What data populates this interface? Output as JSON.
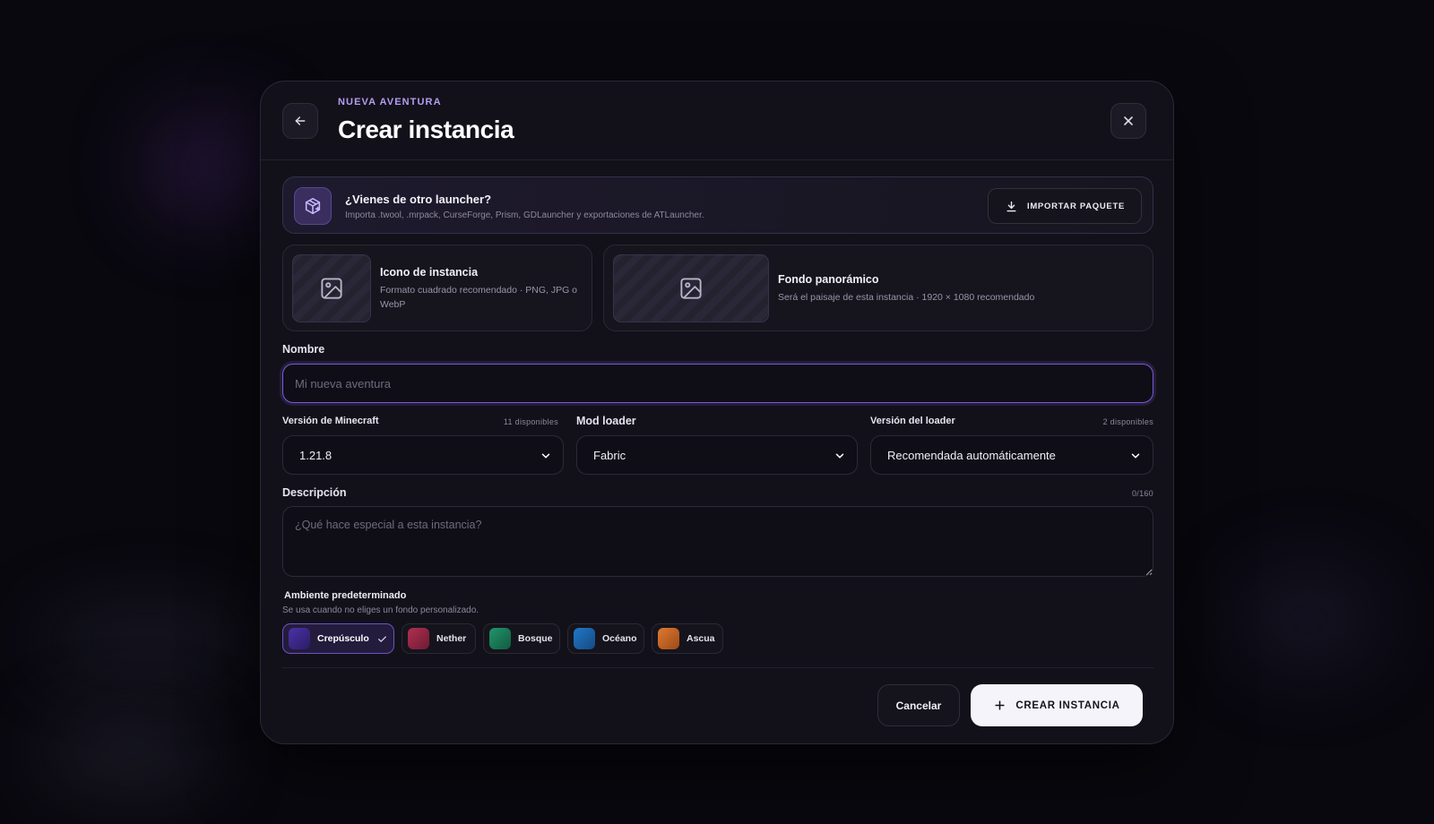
{
  "header": {
    "eyebrow": "NUEVA AVENTURA",
    "title": "Crear instancia"
  },
  "import": {
    "title": "¿Vienes de otro launcher?",
    "subtitle": "Importa .twool, .mrpack, CurseForge, Prism, GDLauncher y exportaciones de ATLauncher.",
    "button_label": "IMPORTAR PAQUETE"
  },
  "media": {
    "icon": {
      "title": "Icono de instancia",
      "subtitle": "Formato cuadrado recomendado · PNG, JPG o WebP"
    },
    "background": {
      "title": "Fondo panorámico",
      "subtitle": "Será el paisaje de esta instancia · 1920 × 1080 recomendado"
    }
  },
  "form": {
    "name": {
      "label": "Nombre",
      "value": "",
      "placeholder": "Mi nueva aventura"
    },
    "minecraft_version": {
      "label": "Versión de Minecraft",
      "count": "11 disponibles",
      "value": "1.21.8"
    },
    "mod_loader": {
      "label": "Mod loader",
      "value": "Fabric"
    },
    "loader_version": {
      "label": "Versión del loader",
      "count": "2 disponibles",
      "value": "Recomendada automáticamente"
    },
    "description": {
      "label": "Descripción",
      "counter": "0/160",
      "value": "",
      "placeholder": "¿Qué hace especial a esta instancia?"
    }
  },
  "ambient": {
    "title": "Ambiente predeterminado",
    "subtitle": "Se usa cuando no eliges un fondo personalizado.",
    "selected": "Crepúsculo",
    "options": [
      {
        "label": "Crepúsculo",
        "color": "#4b32a8",
        "color2": "#2a1d66"
      },
      {
        "label": "Nether",
        "color": "#b03050",
        "color2": "#6e1a34"
      },
      {
        "label": "Bosque",
        "color": "#21956a",
        "color2": "#125a40"
      },
      {
        "label": "Océano",
        "color": "#2277c8",
        "color2": "#154a82"
      },
      {
        "label": "Ascua",
        "color": "#e07a30",
        "color2": "#9a4a18"
      }
    ]
  },
  "footer": {
    "cancel_label": "Cancelar",
    "create_label": "CREAR INSTANCIA"
  },
  "colors": {
    "accent": "#7a5ad6",
    "eyebrow": "#b79df2",
    "background": "#09080f",
    "panel": "#12111a"
  }
}
